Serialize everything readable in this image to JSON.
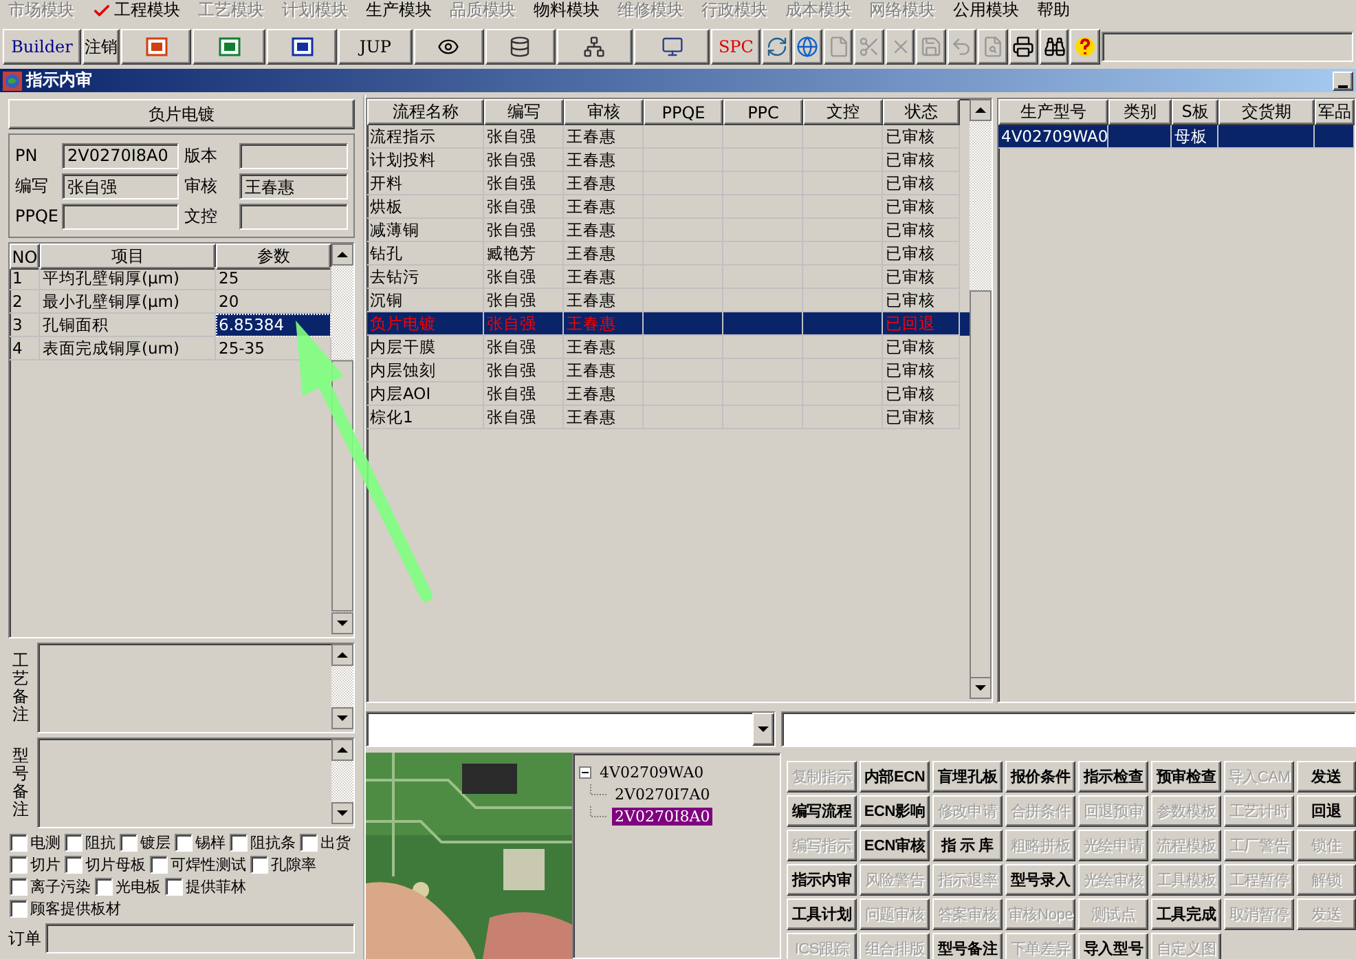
{
  "menu": [
    {
      "label": "市场模块",
      "disabled": true,
      "checked": false
    },
    {
      "label": "工程模块",
      "disabled": false,
      "checked": true
    },
    {
      "label": "工艺模块",
      "disabled": true,
      "checked": false
    },
    {
      "label": "计划模块",
      "disabled": true,
      "checked": false
    },
    {
      "label": "生产模块",
      "disabled": false,
      "checked": false
    },
    {
      "label": "品质模块",
      "disabled": true,
      "checked": false
    },
    {
      "label": "物料模块",
      "disabled": false,
      "checked": false
    },
    {
      "label": "维修模块",
      "disabled": true,
      "checked": false
    },
    {
      "label": "行政模块",
      "disabled": true,
      "checked": false
    },
    {
      "label": "成本模块",
      "disabled": true,
      "checked": false
    },
    {
      "label": "网络模块",
      "disabled": true,
      "checked": false
    },
    {
      "label": "公用模块",
      "disabled": false,
      "checked": false
    },
    {
      "label": "帮助",
      "disabled": false,
      "checked": false
    }
  ],
  "toolbar": [
    {
      "kind": "text",
      "label": "Builder"
    },
    {
      "kind": "text",
      "label": "注销"
    },
    {
      "kind": "icon"
    },
    {
      "kind": "icon"
    },
    {
      "kind": "icon"
    },
    {
      "kind": "text",
      "label": "JUP"
    },
    {
      "kind": "icon"
    },
    {
      "kind": "icon"
    },
    {
      "kind": "icon"
    },
    {
      "kind": "icon"
    },
    {
      "kind": "text",
      "label": "SPC"
    },
    {
      "kind": "icon"
    },
    {
      "kind": "icon"
    },
    {
      "kind": "icon"
    },
    {
      "kind": "icon"
    },
    {
      "kind": "icon"
    },
    {
      "kind": "icon"
    },
    {
      "kind": "icon"
    },
    {
      "kind": "icon"
    },
    {
      "kind": "icon"
    },
    {
      "kind": "icon"
    },
    {
      "kind": "icon"
    }
  ],
  "window": {
    "title": "指示内审"
  },
  "step": {
    "title": "负片电镀",
    "fields": [
      {
        "label": "PN",
        "value": "2V0270I8A0"
      },
      {
        "label": "版本"
      },
      {
        "label": "编写",
        "value": "张自强"
      },
      {
        "label": "审核",
        "value": "王春惠"
      },
      {
        "label": "PPQE"
      },
      {
        "label": "文控"
      }
    ]
  },
  "param_table": {
    "columns": [
      "NO",
      "项目",
      "参数"
    ],
    "rows": [
      {
        "no": "1",
        "item": "平均孔壁铜厚(μm)",
        "value": "25",
        "selected": false
      },
      {
        "no": "2",
        "item": "最小孔壁铜厚(μm)",
        "value": "20",
        "selected": false
      },
      {
        "no": "3",
        "item": "孔铜面积",
        "value": "6.85384",
        "selected": true
      },
      {
        "no": "4",
        "item": "表面完成铜厚(um)",
        "value": "25-35",
        "selected": false
      }
    ]
  },
  "notes": [
    {
      "label": "工艺备注"
    },
    {
      "label": "型号备注"
    }
  ],
  "options": [
    {
      "label": "电测",
      "checked": false
    },
    {
      "label": "阻抗",
      "checked": false
    },
    {
      "label": "镀层",
      "checked": false
    },
    {
      "label": "锡样",
      "checked": false
    },
    {
      "label": "阻抗条",
      "checked": false
    },
    {
      "label": "出货",
      "checked": false
    },
    {
      "label": "切片",
      "checked": false
    },
    {
      "label": "切片母板",
      "checked": false
    },
    {
      "label": "可焊性测试",
      "checked": false
    },
    {
      "label": "孔隙率",
      "checked": false
    },
    {
      "label": "离子污染",
      "checked": false
    },
    {
      "label": "光电板",
      "checked": false
    },
    {
      "label": "提供菲林",
      "checked": false
    },
    {
      "label": "顾客提供板材",
      "checked": false
    }
  ],
  "order": {
    "label": "订单"
  },
  "flow_table": {
    "columns": [
      "流程名称",
      "编写",
      "审核",
      "PPQE",
      "PPC",
      "文控",
      "状态"
    ],
    "rows": [
      {
        "name": "流程指示",
        "writer": "张自强",
        "reviewer": "王春惠",
        "status": "已审核",
        "selected": false
      },
      {
        "name": "计划投料",
        "writer": "张自强",
        "reviewer": "王春惠",
        "status": "已审核",
        "selected": false
      },
      {
        "name": "开料",
        "writer": "张自强",
        "reviewer": "王春惠",
        "status": "已审核",
        "selected": false
      },
      {
        "name": "烘板",
        "writer": "张自强",
        "reviewer": "王春惠",
        "status": "已审核",
        "selected": false
      },
      {
        "name": "减薄铜",
        "writer": "张自强",
        "reviewer": "王春惠",
        "status": "已审核",
        "selected": false
      },
      {
        "name": "钻孔",
        "writer": "臧艳芳",
        "reviewer": "王春惠",
        "status": "已审核",
        "selected": false
      },
      {
        "name": "去钻污",
        "writer": "张自强",
        "reviewer": "王春惠",
        "status": "已审核",
        "selected": false
      },
      {
        "name": "沉铜",
        "writer": "张自强",
        "reviewer": "王春惠",
        "status": "已审核",
        "selected": false
      },
      {
        "name": "负片电镀",
        "writer": "张自强",
        "reviewer": "王春惠",
        "status": "已回退",
        "selected": true
      },
      {
        "name": "内层干膜",
        "writer": "张自强",
        "reviewer": "王春惠",
        "status": "已审核",
        "selected": false
      },
      {
        "name": "内层蚀刻",
        "writer": "张自强",
        "reviewer": "王春惠",
        "status": "已审核",
        "selected": false
      },
      {
        "name": "内层AOI",
        "writer": "张自强",
        "reviewer": "王春惠",
        "status": "已审核",
        "selected": false
      },
      {
        "name": "棕化1",
        "writer": "张自强",
        "reviewer": "王春惠",
        "status": "已审核",
        "selected": false
      }
    ]
  },
  "product_table": {
    "columns": [
      "生产型号",
      "类别",
      "S板",
      "交货期",
      "军品"
    ],
    "rows": [
      {
        "model": "4V02709WA0",
        "s_board": "母板",
        "selected": true
      }
    ]
  },
  "tree": {
    "items": [
      {
        "label": "4V02709WA0",
        "expanded": true,
        "selected": false,
        "children": [
          {
            "label": "2V0270I7A0",
            "selected": false
          },
          {
            "label": "2V0270I8A0",
            "selected": true
          }
        ]
      }
    ]
  },
  "actions": [
    [
      {
        "label": "复制指示",
        "disabled": true
      },
      {
        "label": "内部ECN",
        "disabled": false
      },
      {
        "label": "盲埋孔板",
        "disabled": false
      },
      {
        "label": "报价条件",
        "disabled": false
      },
      {
        "label": "指示检查",
        "disabled": false
      },
      {
        "label": "预审检查",
        "disabled": false
      },
      {
        "label": "导入CAM",
        "disabled": true
      },
      {
        "label": "发送",
        "disabled": false
      }
    ],
    [
      {
        "label": "编写流程",
        "disabled": false
      },
      {
        "label": "ECN影响",
        "disabled": false
      },
      {
        "label": "修改申请",
        "disabled": true
      },
      {
        "label": "合拼条件",
        "disabled": true
      },
      {
        "label": "回退预审",
        "disabled": true
      },
      {
        "label": "参数模板",
        "disabled": true
      },
      {
        "label": "工艺计时",
        "disabled": true
      },
      {
        "label": "回退",
        "disabled": false
      }
    ],
    [
      {
        "label": "编写指示",
        "disabled": true
      },
      {
        "label": "ECN审核",
        "disabled": false
      },
      {
        "label": "指 示 库",
        "disabled": false
      },
      {
        "label": "粗略拼板",
        "disabled": true
      },
      {
        "label": "光绘申请",
        "disabled": true
      },
      {
        "label": "流程模板",
        "disabled": true
      },
      {
        "label": "工厂警告",
        "disabled": true
      },
      {
        "label": "锁住",
        "disabled": true
      }
    ],
    [
      {
        "label": "指示内审",
        "disabled": false
      },
      {
        "label": "风险警告",
        "disabled": true
      },
      {
        "label": "指示退率",
        "disabled": true
      },
      {
        "label": "型号录入",
        "disabled": false
      },
      {
        "label": "光绘审核",
        "disabled": true
      },
      {
        "label": "工具模板",
        "disabled": true
      },
      {
        "label": "工程暂停",
        "disabled": true
      },
      {
        "label": "解锁",
        "disabled": true
      }
    ],
    [
      {
        "label": "工具计划",
        "disabled": false
      },
      {
        "label": "问题审核",
        "disabled": true
      },
      {
        "label": "答案审核",
        "disabled": true
      },
      {
        "label": "审核Nope",
        "disabled": true
      },
      {
        "label": "测试点",
        "disabled": true
      },
      {
        "label": "工具完成",
        "disabled": false
      },
      {
        "label": "取消暂停",
        "disabled": true
      },
      {
        "label": "发送",
        "disabled": true
      }
    ],
    [
      {
        "label": "ICS跟踪",
        "disabled": true
      },
      {
        "label": "组合排版",
        "disabled": true
      },
      {
        "label": "型号备注",
        "disabled": false
      },
      {
        "label": "下单差异",
        "disabled": true
      },
      {
        "label": "导入型号",
        "disabled": false
      },
      {
        "label": "自定义图",
        "disabled": true
      }
    ]
  ]
}
